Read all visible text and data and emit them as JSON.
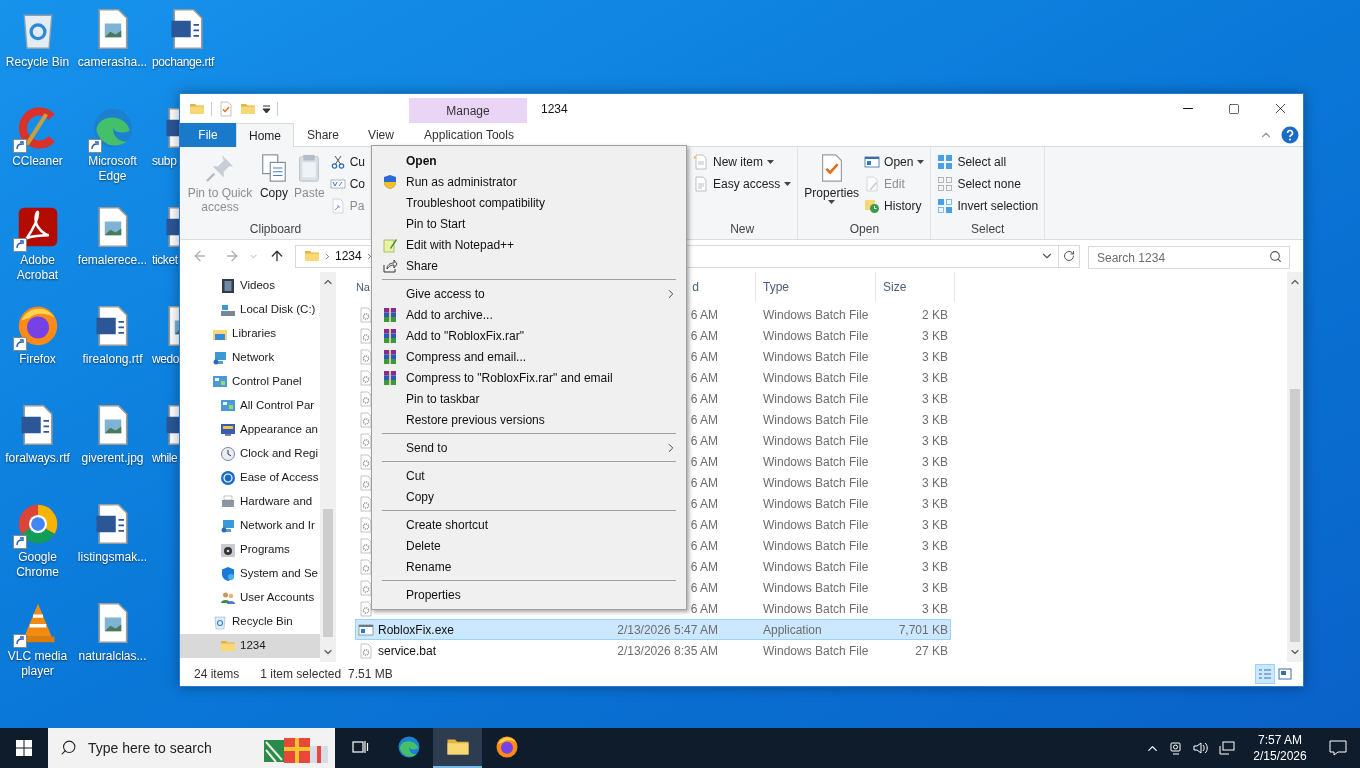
{
  "desktop": {
    "columns": [
      [
        {
          "label": "Recycle Bin",
          "kind": "recycle",
          "shortcut": false
        },
        {
          "label": "CCleaner",
          "kind": "ccleaner",
          "shortcut": true
        },
        {
          "label": "Adobe Acrobat",
          "kind": "acrobat",
          "shortcut": true
        },
        {
          "label": "Firefox",
          "kind": "firefox",
          "shortcut": true
        },
        {
          "label": "foralways.rtf",
          "kind": "word",
          "shortcut": false
        },
        {
          "label": "Google Chrome",
          "kind": "chrome",
          "shortcut": true
        },
        {
          "label": "VLC media player",
          "kind": "vlc",
          "shortcut": true
        }
      ],
      [
        {
          "label": "camerasha...",
          "kind": "image",
          "shortcut": false
        },
        {
          "label": "Microsoft Edge",
          "kind": "edge",
          "shortcut": true
        },
        {
          "label": "femalerece...",
          "kind": "image",
          "shortcut": false
        },
        {
          "label": "firealong.rtf",
          "kind": "word",
          "shortcut": false
        },
        {
          "label": "giverent.jpg",
          "kind": "image",
          "shortcut": false
        },
        {
          "label": "listingsmak...",
          "kind": "word",
          "shortcut": false
        },
        {
          "label": "naturalclas...",
          "kind": "image",
          "shortcut": false
        }
      ],
      [
        {
          "label": "pochange.rtf",
          "kind": "word",
          "shortcut": false
        },
        {
          "label": "subp",
          "kind": "word",
          "shortcut": false
        },
        {
          "label": "ticket",
          "kind": "word",
          "shortcut": false
        },
        {
          "label": "wedo",
          "kind": "image",
          "shortcut": false
        },
        {
          "label": "while",
          "kind": "word",
          "shortcut": false
        }
      ]
    ]
  },
  "explorer": {
    "title": "1234",
    "context_group": "Manage",
    "tabs": [
      {
        "label": "File",
        "kind": "file",
        "selected": false
      },
      {
        "label": "Home",
        "kind": "tab",
        "selected": true
      },
      {
        "label": "Share",
        "kind": "tab",
        "selected": false
      },
      {
        "label": "View",
        "kind": "tab",
        "selected": false
      },
      {
        "label": "Application Tools",
        "kind": "context",
        "selected": false
      }
    ],
    "ribbon": {
      "groups": [
        {
          "label": "Clipboard",
          "buttons": [
            {
              "label": "Pin to Quick access",
              "kind": "pin",
              "disabled": true,
              "dropdown": false
            },
            {
              "label": "Copy",
              "kind": "copy",
              "disabled": false,
              "dropdown": false
            },
            {
              "label": "Paste",
              "kind": "paste",
              "disabled": true,
              "dropdown": false
            },
            {
              "label": "Cu",
              "kind": "scissors",
              "disabled": false,
              "dropdown": false
            },
            {
              "label": "Co",
              "kind": "path",
              "disabled": false,
              "dropdown": false
            },
            {
              "label": "Pa",
              "kind": "shortcut",
              "disabled": true,
              "dropdown": false
            }
          ]
        },
        {
          "label": "New",
          "buttons": [
            {
              "label": "New item",
              "kind": "newitem",
              "disabled": false,
              "dropdown": true
            },
            {
              "label": "Easy access",
              "kind": "easy",
              "disabled": false,
              "dropdown": true
            }
          ]
        },
        {
          "label": "Open",
          "buttons": [
            {
              "label": "Properties",
              "kind": "properties",
              "disabled": false,
              "dropdown": true
            },
            {
              "label": "Open",
              "kind": "open",
              "disabled": false,
              "dropdown": true
            },
            {
              "label": "Edit",
              "kind": "edit",
              "disabled": true,
              "dropdown": false
            },
            {
              "label": "History",
              "kind": "history",
              "disabled": false,
              "dropdown": false
            }
          ]
        },
        {
          "label": "Select",
          "buttons": [
            {
              "label": "Select all",
              "kind": "selectall",
              "disabled": false,
              "dropdown": false
            },
            {
              "label": "Select none",
              "kind": "selectnone",
              "disabled": false,
              "dropdown": false
            },
            {
              "label": "Invert selection",
              "kind": "invert",
              "disabled": false,
              "dropdown": false
            }
          ]
        }
      ]
    },
    "address": {
      "crumb": "1234",
      "search_placeholder": "Search 1234"
    },
    "nav_pane": {
      "items": [
        {
          "kind": "group",
          "children": [
            {
              "kind": "videos",
              "label": "Videos",
              "selected": false
            },
            {
              "kind": "disk",
              "label": "Local Disk (C:)",
              "selected": false
            }
          ]
        },
        {
          "kind": "libraries",
          "label": "Libraries",
          "selected": false
        },
        {
          "kind": "network",
          "label": "Network",
          "selected": false
        },
        {
          "kind": "control",
          "label": "Control Panel",
          "selected": false,
          "children": [
            {
              "kind": "control",
              "label": "All Control Par",
              "selected": false
            },
            {
              "kind": "appearance",
              "label": "Appearance an",
              "selected": false
            },
            {
              "kind": "clock",
              "label": "Clock and Regi",
              "selected": false
            },
            {
              "kind": "ease",
              "label": "Ease of Access",
              "selected": false
            },
            {
              "kind": "hardware",
              "label": "Hardware and",
              "selected": false
            },
            {
              "kind": "netint",
              "label": "Network and Ir",
              "selected": false
            },
            {
              "kind": "programs",
              "label": "Programs",
              "selected": false
            },
            {
              "kind": "system",
              "label": "System and Se",
              "selected": false
            },
            {
              "kind": "users",
              "label": "User Accounts",
              "selected": false
            }
          ]
        },
        {
          "kind": "recycle",
          "label": "Recycle Bin",
          "selected": false
        },
        {
          "kind": "group",
          "children": [
            {
              "kind": "folder",
              "label": "1234",
              "selected": true
            }
          ]
        }
      ]
    },
    "file_list": {
      "columns": [
        "Na",
        "d",
        "Type",
        "Size"
      ],
      "rows": [
        {
          "kind": "batch",
          "date": "6 AM",
          "type": "Windows Batch File",
          "size": "2 KB",
          "selected": false
        },
        {
          "kind": "batch",
          "date": "6 AM",
          "type": "Windows Batch File",
          "size": "3 KB",
          "selected": false
        },
        {
          "kind": "batch",
          "date": "6 AM",
          "type": "Windows Batch File",
          "size": "3 KB",
          "selected": false
        },
        {
          "kind": "batch",
          "date": "6 AM",
          "type": "Windows Batch File",
          "size": "3 KB",
          "selected": false
        },
        {
          "kind": "batch",
          "date": "6 AM",
          "type": "Windows Batch File",
          "size": "3 KB",
          "selected": false
        },
        {
          "kind": "batch",
          "date": "6 AM",
          "type": "Windows Batch File",
          "size": "3 KB",
          "selected": false
        },
        {
          "kind": "batch",
          "date": "6 AM",
          "type": "Windows Batch File",
          "size": "3 KB",
          "selected": false
        },
        {
          "kind": "batch",
          "date": "6 AM",
          "type": "Windows Batch File",
          "size": "3 KB",
          "selected": false
        },
        {
          "kind": "batch",
          "date": "6 AM",
          "type": "Windows Batch File",
          "size": "3 KB",
          "selected": false
        },
        {
          "kind": "batch",
          "date": "6 AM",
          "type": "Windows Batch File",
          "size": "3 KB",
          "selected": false
        },
        {
          "kind": "batch",
          "date": "6 AM",
          "type": "Windows Batch File",
          "size": "3 KB",
          "selected": false
        },
        {
          "kind": "batch",
          "date": "6 AM",
          "type": "Windows Batch File",
          "size": "3 KB",
          "selected": false
        },
        {
          "kind": "batch",
          "date": "6 AM",
          "type": "Windows Batch File",
          "size": "3 KB",
          "selected": false
        },
        {
          "kind": "batch",
          "date": "6 AM",
          "type": "Windows Batch File",
          "size": "3 KB",
          "selected": false
        },
        {
          "kind": "batch",
          "date": "6 AM",
          "type": "Windows Batch File",
          "size": "3 KB",
          "selected": false
        },
        {
          "kind": "app",
          "name": "RobloxFix.exe",
          "date": "2/13/2026 5:47 AM",
          "type": "Application",
          "size": "7,701 KB",
          "selected": true
        },
        {
          "kind": "batch",
          "name": "service.bat",
          "date": "2/13/2026 8:35 AM",
          "type": "Windows Batch File",
          "size": "27 KB",
          "selected": false
        }
      ]
    },
    "status_bar": {
      "count": "24 items",
      "selection": "1 item selected",
      "size": "7.51 MB",
      "views": [
        {
          "kind": "details",
          "selected": true
        },
        {
          "kind": "tiles",
          "selected": false
        }
      ]
    }
  },
  "context_menu": {
    "items": [
      {
        "kind": "item",
        "label": "Open",
        "default": true
      },
      {
        "kind": "shield",
        "label": "Run as administrator",
        "default": false
      },
      {
        "kind": "item",
        "label": "Troubleshoot compatibility",
        "default": false
      },
      {
        "kind": "item",
        "label": "Pin to Start",
        "default": false
      },
      {
        "kind": "notepad",
        "label": "Edit with Notepad++",
        "default": false
      },
      {
        "kind": "share",
        "label": "Share",
        "default": false
      },
      {
        "kind": "separator"
      },
      {
        "kind": "submenu",
        "label": "Give access to",
        "default": false
      },
      {
        "kind": "winrar",
        "label": "Add to archive...",
        "default": false
      },
      {
        "kind": "winrar",
        "label": "Add to \"RobloxFix.rar\"",
        "default": false
      },
      {
        "kind": "winrar",
        "label": "Compress and email...",
        "default": false
      },
      {
        "kind": "winrar",
        "label": "Compress to \"RobloxFix.rar\" and email",
        "default": false
      },
      {
        "kind": "item",
        "label": "Pin to taskbar",
        "default": false
      },
      {
        "kind": "item",
        "label": "Restore previous versions",
        "default": false
      },
      {
        "kind": "separator"
      },
      {
        "kind": "submenu",
        "label": "Send to",
        "default": false
      },
      {
        "kind": "separator"
      },
      {
        "kind": "item",
        "label": "Cut",
        "default": false
      },
      {
        "kind": "item",
        "label": "Copy",
        "default": false
      },
      {
        "kind": "separator"
      },
      {
        "kind": "item",
        "label": "Create shortcut",
        "default": false
      },
      {
        "kind": "item",
        "label": "Delete",
        "default": false
      },
      {
        "kind": "item",
        "label": "Rename",
        "default": false
      },
      {
        "kind": "separator"
      },
      {
        "kind": "item",
        "label": "Properties",
        "default": false
      }
    ]
  },
  "taskbar": {
    "search_placeholder": "Type here to search",
    "apps": [
      {
        "kind": "taskview",
        "active": false
      },
      {
        "kind": "edge",
        "active": false
      },
      {
        "kind": "explorer",
        "active": true
      },
      {
        "kind": "firefox",
        "active": false
      }
    ],
    "time": "7:57 AM",
    "date": "2/15/2026"
  }
}
